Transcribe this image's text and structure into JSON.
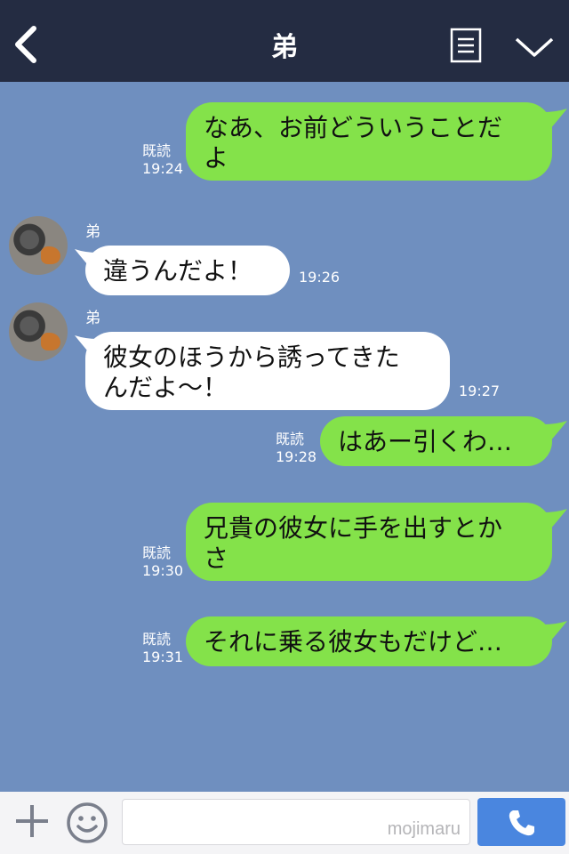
{
  "header": {
    "title": "弟",
    "back_icon": "chevron-left-icon",
    "menu_icon": "list-icon",
    "collapse_icon": "chevron-down-icon"
  },
  "messages": [
    {
      "dir": "out",
      "text": "なあ、お前どういうことだよ",
      "lines": [
        "なあ、お前どういうことだ",
        "よ"
      ],
      "read": "既読",
      "time": "19:24"
    },
    {
      "dir": "in",
      "sender": "弟",
      "text": "違うんだよ！",
      "time": "19:26"
    },
    {
      "dir": "in",
      "sender": "弟",
      "text": "彼女のほうから誘ってきたんだよ〜！",
      "lines": [
        "彼女のほうから誘ってきた",
        "んだよ〜！"
      ],
      "time": "19:27"
    },
    {
      "dir": "out",
      "text": "はあー引くわ…",
      "read": "既読",
      "time": "19:28"
    },
    {
      "dir": "out",
      "text": "兄貴の彼女に手を出すとかさ",
      "lines": [
        "兄貴の彼女に手を出すとか",
        "さ"
      ],
      "read": "既読",
      "time": "19:30"
    },
    {
      "dir": "out",
      "text": "それに乗る彼女もだけど…",
      "read": "既読",
      "time": "19:31"
    }
  ],
  "footer": {
    "input_placeholder": "",
    "watermark": "mojimaru",
    "plus_icon": "plus-icon",
    "sticker_icon": "smiley-icon",
    "call_icon": "phone-icon"
  },
  "colors": {
    "header_bg": "#242c42",
    "chat_bg": "#6f8fbf",
    "outgoing_bubble": "#84e24a",
    "incoming_bubble": "#ffffff",
    "call_button": "#4a86df"
  }
}
